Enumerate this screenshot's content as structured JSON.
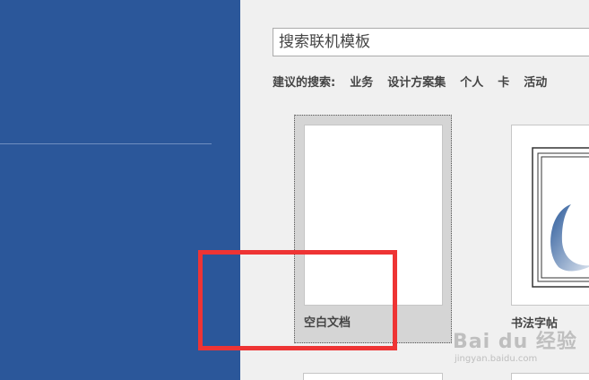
{
  "search": {
    "value": "搜索联机模板"
  },
  "suggested": {
    "label": "建议的搜索:",
    "items": [
      "业务",
      "设计方案集",
      "个人",
      "卡",
      "活动"
    ]
  },
  "templates": [
    {
      "name": "空白文档"
    },
    {
      "name": "书法字帖"
    }
  ],
  "watermark": {
    "brand": "Bai du 经验",
    "url": "jingyan.baidu.com"
  },
  "colors": {
    "sidebar": "#2b579a",
    "highlight": "#ee3434",
    "background": "#f0f0f0"
  }
}
